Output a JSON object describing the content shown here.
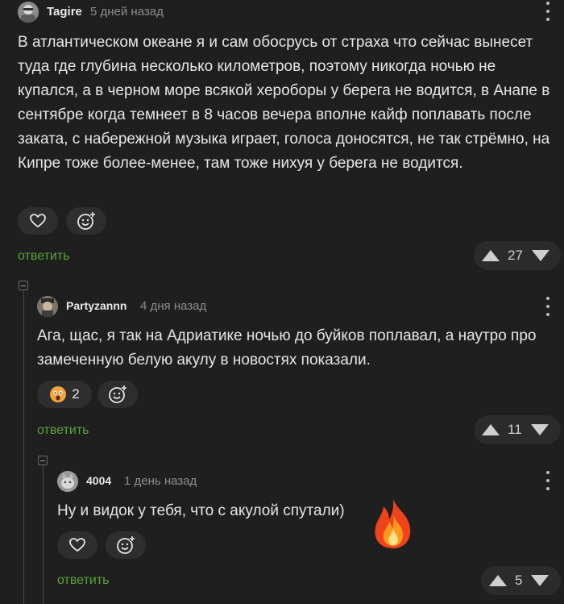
{
  "comments": [
    {
      "author": "Tagire",
      "time": "5 дней назад",
      "text": "В атлантическом океане я и сам обосрусь от страха что сейчас вынесет туда где глубина несколько километров, поэтому никогда ночью не купался, а в черном море всякой хероборы у берега не водится, в Анапе в сентябре когда темнеет в 8 часов вечера вполне кайф поплавать после заката, с набережной музыка играет, голоса доносятся, не так стрёмно, на Кипре тоже более-менее, там тоже нихуя у берега не водится.",
      "reply": "ответить",
      "rating": "27",
      "reaction_icon": "heart-icon"
    },
    {
      "author": "Partyzannn",
      "time": "4 дня назад",
      "text": "Ага, щас, я так на Адриатике ночью до буйков поплавал, а наутро про замеченную белую акулу в новостях показали.",
      "reply": "ответить",
      "rating": "11",
      "reaction_icon": "scared-face-icon",
      "reaction_count": "2"
    },
    {
      "author": "4004",
      "time": "1 день назад",
      "text": "Ну и видок у тебя, что с акулой спутали)",
      "reply": "ответить",
      "rating": "5",
      "reaction_icon": "heart-icon",
      "sticker": "fire-emoji"
    }
  ],
  "colors": {
    "background": "#1f1f1f",
    "reply_link": "#5aa23a",
    "text": "#e6e6e6",
    "muted": "#8d8d8d"
  }
}
